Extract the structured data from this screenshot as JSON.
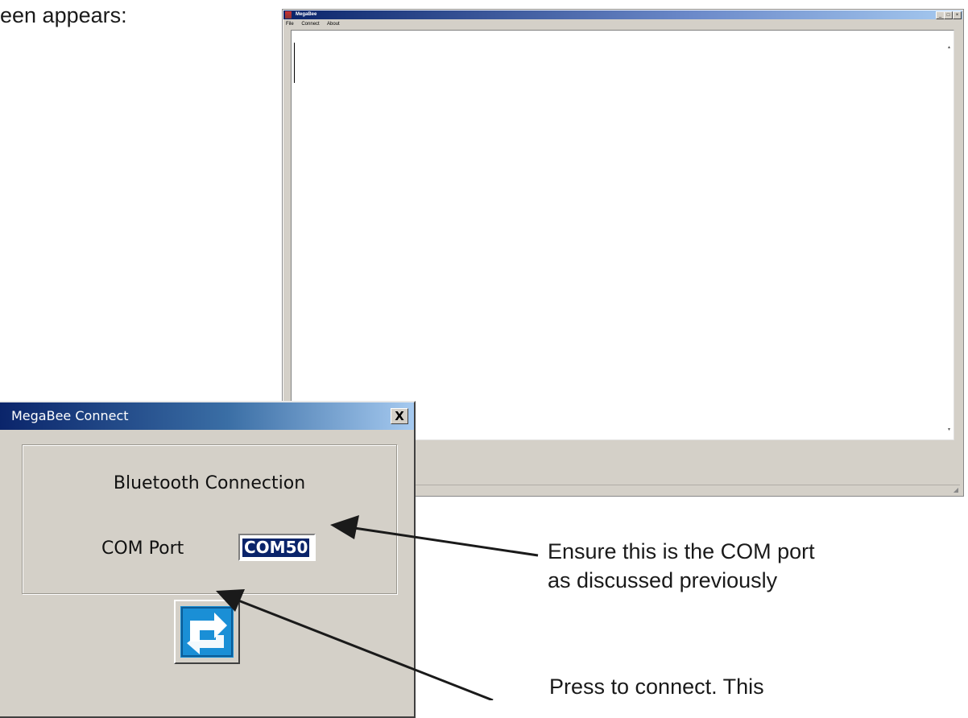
{
  "doc": {
    "intro_text": "een appears:",
    "annotation_com_line1": "Ensure this is the COM port",
    "annotation_com_line2": "as discussed previously",
    "annotation_connect_partial": "Press to connect. This"
  },
  "main_window": {
    "title": "MegaBee",
    "menu": [
      "File",
      "Connect",
      "About"
    ],
    "minimize": "_",
    "maximize": "□",
    "close": "×"
  },
  "dialog": {
    "title": "MegaBee Connect",
    "close_label": "X",
    "group_title": "Bluetooth Connection",
    "com_port_label": "COM Port",
    "com_port_value": "COM50",
    "connect_icon": "swap-arrows-icon"
  },
  "colors": {
    "titlebar": "#0a246a",
    "window_face": "#d4d0c8",
    "connect_icon_bg": "#1a8fd6"
  }
}
